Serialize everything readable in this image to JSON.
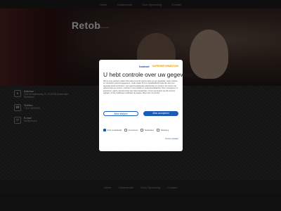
{
  "topnav": {
    "items": [
      "Home",
      "Gastenboek",
      "Over Opvoering",
      "Contact"
    ]
  },
  "hero": {
    "logo": "Retob",
    "logo_sub": "Retobeek"
  },
  "contacts": [
    {
      "icon": "location-icon",
      "title": "Adresse",
      "text": "Curt Schwittersweg 20, 1018 DB Amsterdam, Nederland"
    },
    {
      "icon": "phone-icon",
      "title": "Telefon",
      "text": "+31 6 00000000"
    },
    {
      "icon": "mail-icon",
      "title": "E-mail",
      "text": "info@retob.nl"
    }
  ],
  "footer": {
    "items": [
      "Home",
      "Gastenboek",
      "Over Opvoering",
      "Contact"
    ]
  },
  "consent": {
    "logo_a": "hostnet",
    "logo_b": "SUPERINFORMATION",
    "title": "U hebt controle over uw gegevens",
    "body": "Wij en onze partners slaan informatie op en/of openen deze op een apparaat, zoals cookies, en verwerken persoonsgegevens, zoals unieke ID's en standaardinformatie die door een apparaat wordt verzonden, voor gepersonaliseerde advertenties en content, het meten van advertenties en content, inzichten in het publiek en productontwikkeling. Door 'Accepteren' te selecteren, geeft u toestemming voor deze doeleinden. U kunt uw keuzes op elk moment wijzigen via de instellingen onderaan de pagina. Meer over uw privacy",
    "decline": "Alles afwijzen",
    "accept": "Alles accepteren",
    "checks": [
      {
        "label": "Strikt noodzakelijk",
        "on": true
      },
      {
        "label": "Functioneel",
        "on": false
      },
      {
        "label": "Statistieken",
        "on": false
      },
      {
        "label": "Marketing",
        "on": false
      }
    ],
    "save": "Keuze opslaan"
  }
}
